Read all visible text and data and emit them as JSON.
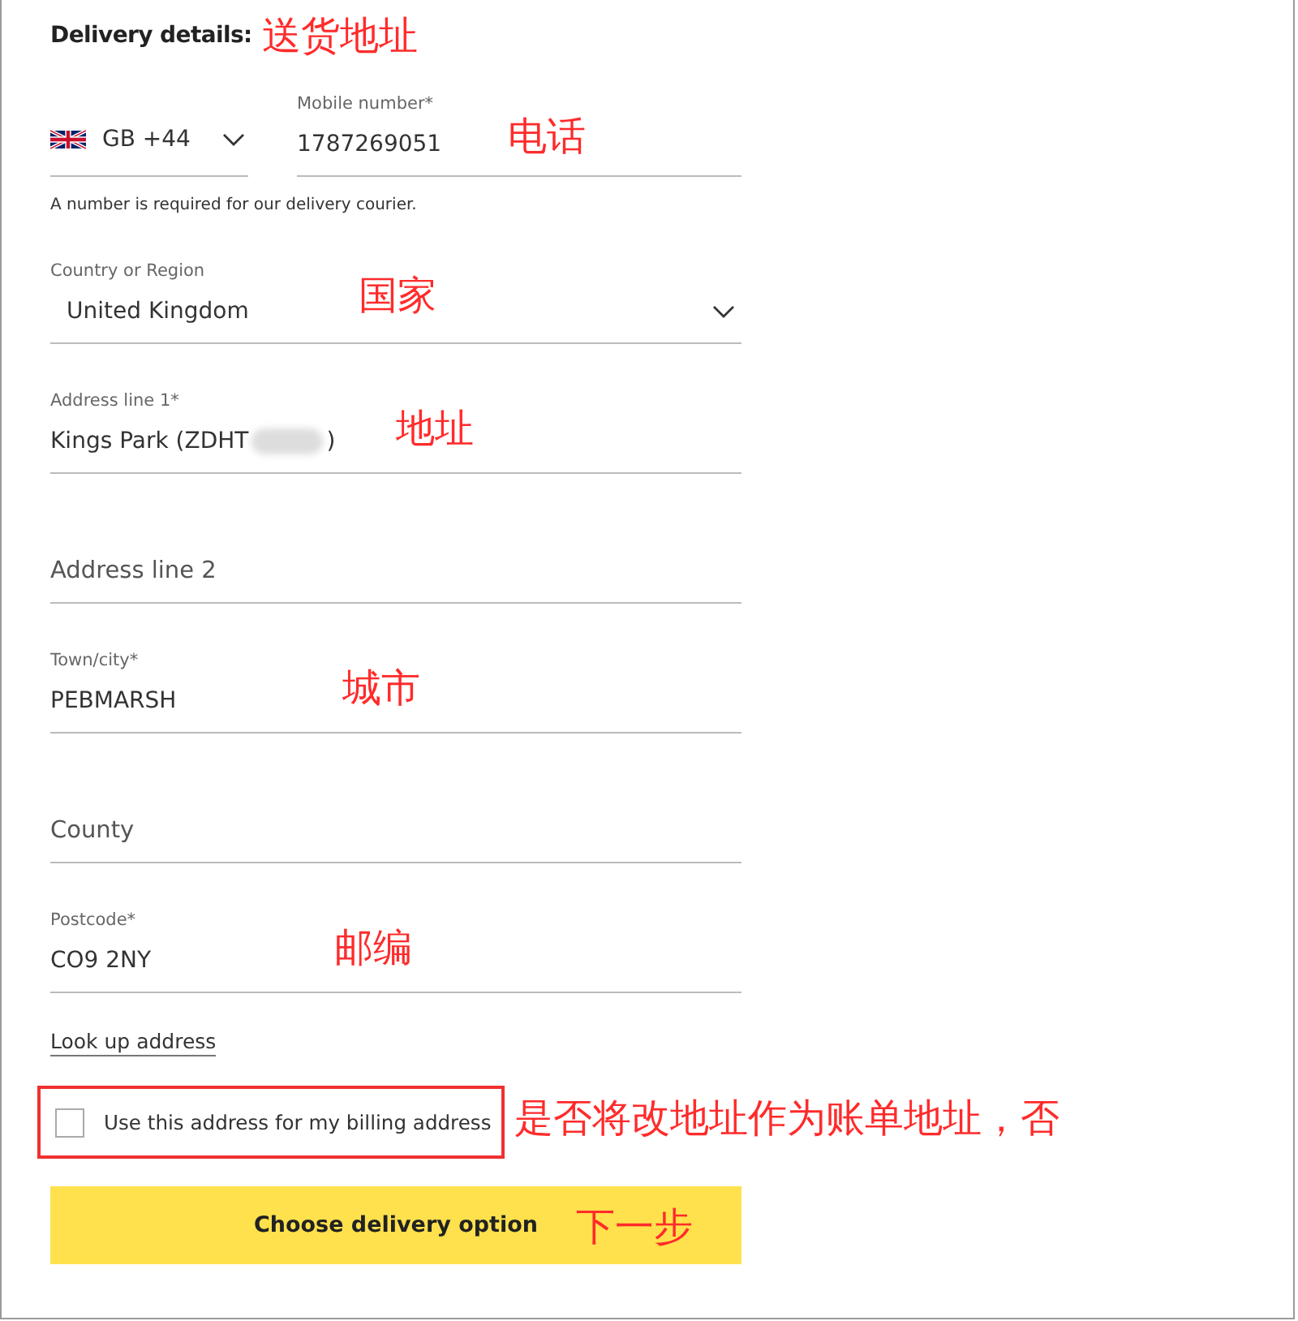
{
  "heading": "Delivery details:",
  "heading_note": "送货地址",
  "phone": {
    "country_code": "GB +44",
    "label": "Mobile number*",
    "value": "1787269051",
    "note": "电话",
    "helper": "A number is required for our delivery courier."
  },
  "fields": [
    {
      "kind": "select",
      "label": "Country or Region",
      "value": "United Kingdom",
      "note": "国家"
    },
    {
      "kind": "input",
      "label": "Address line 1*",
      "value": "Kings Park (ZDHT",
      "value_after": ")",
      "redacted": true,
      "note": "地址"
    },
    {
      "kind": "empty",
      "placeholder": "Address line 2"
    },
    {
      "kind": "input",
      "label": "Town/city*",
      "value": "PEBMARSH",
      "note": "城市"
    },
    {
      "kind": "empty",
      "placeholder": "County"
    },
    {
      "kind": "input",
      "label": "Postcode*",
      "value": "CO9 2NY",
      "note": "邮编"
    }
  ],
  "lookup_link": "Look up address",
  "billing": {
    "label": "Use this address for my billing address",
    "checked": false,
    "note": "是否将改地址作为账单地址，否"
  },
  "submit": {
    "label": "Choose delivery option",
    "note": "下一步"
  }
}
